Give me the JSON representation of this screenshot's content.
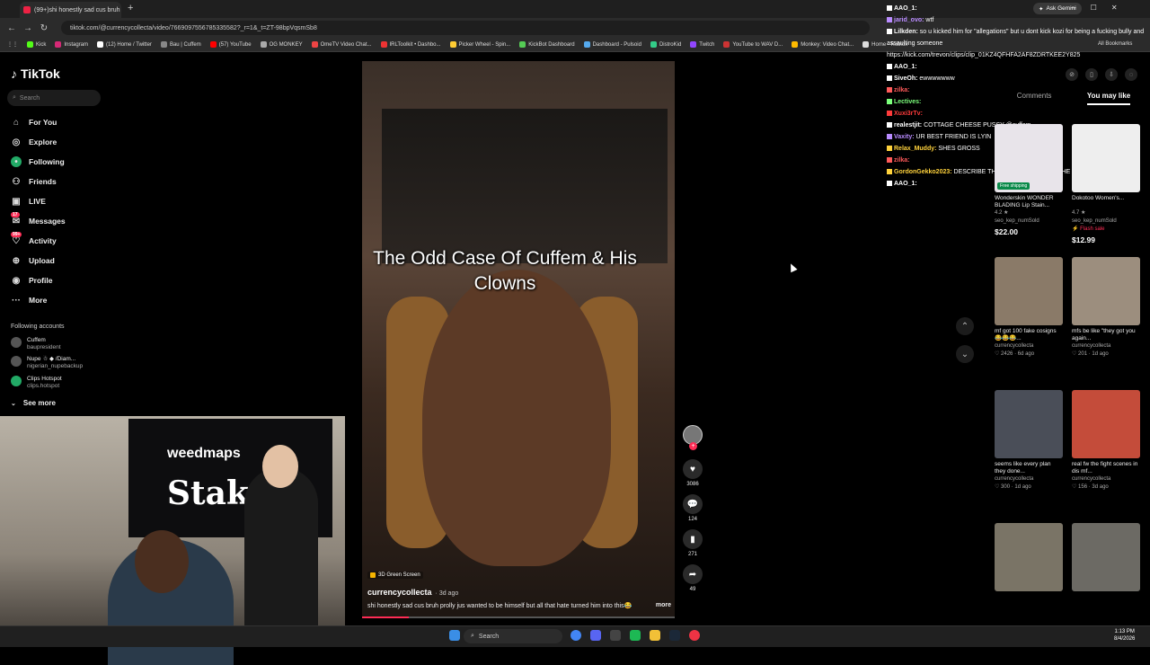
{
  "browser": {
    "tab_title": "(99+)shi honestly sad cus bruh",
    "url": "tiktok.com/@currencycollecta/video/7669097556785335582?_r=1&_t=ZT-98bpVqsmSb8",
    "gemini": "Ask Gemini",
    "bookmarks": [
      "Kick",
      "Instagram",
      "(12) Home / Twitter",
      "Bau | Cuffem",
      "(57) YouTube",
      "OG MONKEY",
      "OmeTV Video Chat...",
      "IRLToolkit • Dashbo...",
      "Picker Wheel - Spin...",
      "KickBot Dashboard",
      "Dashboard - Pulsoid",
      "DistroKid",
      "Twitch",
      "YouTube to WAV D...",
      "Monkey: Video Chat...",
      "Home - Roblox"
    ],
    "all_bookmarks": "All Bookmarks"
  },
  "tiktok": {
    "logo": "TikTok",
    "search_placeholder": "Search",
    "nav": [
      {
        "label": "For You",
        "icon": "home-icon"
      },
      {
        "label": "Explore",
        "icon": "compass-icon"
      },
      {
        "label": "Following",
        "icon": "following-icon"
      },
      {
        "label": "Friends",
        "icon": "friends-icon"
      },
      {
        "label": "LIVE",
        "icon": "live-icon"
      },
      {
        "label": "Messages",
        "icon": "messages-icon",
        "badge": "17"
      },
      {
        "label": "Activity",
        "icon": "activity-icon",
        "badge": "99+"
      },
      {
        "label": "Upload",
        "icon": "upload-icon"
      },
      {
        "label": "Profile",
        "icon": "profile-icon"
      },
      {
        "label": "More",
        "icon": "more-icon"
      }
    ],
    "following_header": "Following accounts",
    "following": [
      {
        "name": "Cuffem",
        "handle": "baupresident"
      },
      {
        "name": "Nupe ☃ ◆ /Diam...",
        "handle": "nigerian_nupebackup"
      },
      {
        "name": "Clips Hotspot",
        "handle": "clips.hotspot"
      }
    ],
    "see_more": "See more"
  },
  "stream": {
    "banner_brand": "weedmaps",
    "banner_text": "Stake"
  },
  "video": {
    "title": "The Odd Case Of Cuffem & His Clowns",
    "effect": "3D Green Screen",
    "author": "currencycollecta",
    "age": "· 3d ago",
    "caption": "shi honestly sad cus bruh prolly jus wanted to be himself but all that hate turned him into this😂",
    "more": "more",
    "likes": "3086",
    "comments": "124",
    "saves": "271",
    "shares": "49",
    "progress": 0.15
  },
  "chat": [
    {
      "user": "AAO_1:",
      "msg": "",
      "color": "#ffffff"
    },
    {
      "user": "jarid_ovo:",
      "msg": "wtf",
      "color": "#b98bff"
    },
    {
      "user": "Lilkden:",
      "msg": "so u kicked him for \"allegations\" but u dont kick kozi for being a fucking bully and assaulting someone",
      "color": "#ffffff"
    },
    {
      "user": "",
      "msg": "https://kick.com/trevon/clips/clip_01KZ4QFHFA2AF8ZDRTKEE2Y825",
      "color": "#ffffff"
    },
    {
      "user": "AAO_1:",
      "msg": "",
      "color": "#ffffff"
    },
    {
      "user": "SiveOh:",
      "msg": "ewwwwwww",
      "color": "#ffffff"
    },
    {
      "user": "zilka:",
      "msg": "",
      "color": "#ff5a5a"
    },
    {
      "user": "Lectives:",
      "msg": "",
      "color": "#7cff7c"
    },
    {
      "user": "Xuxi3rTv:",
      "msg": "",
      "color": "#ff3b3b"
    },
    {
      "user": "realestjit:",
      "msg": "COTTAGE CHEESE PUSSY @cuffem",
      "color": "#ffffff"
    },
    {
      "user": "Vaxity:",
      "msg": "UR BEST FRIEND IS LYIN",
      "color": "#b98bff"
    },
    {
      "user": "Relax_Muddy:",
      "msg": "SHES GROSS",
      "color": "#ffd23c"
    },
    {
      "user": "zilka:",
      "msg": "",
      "color": "#ff5a5a"
    },
    {
      "user": "GordonGekko2023:",
      "msg": "DESCRIBE THE SMELL DESCRIBE THE SMELL",
      "color": "#ffd23c"
    },
    {
      "user": "AAO_1:",
      "msg": "",
      "color": "#ffffff"
    }
  ],
  "right_panel": {
    "tab_comments": "Comments",
    "tab_like": "You may like",
    "products": [
      {
        "name": "Wonderskin WONDER BLADING Lip Stain...",
        "rating": "4.2 ★",
        "sold": "seo_kep_numSold",
        "price": "$22.00",
        "tag": "Free shipping",
        "color": "#e8e4ea"
      },
      {
        "name": "Dokotoo Women's...",
        "rating": "4.7 ★",
        "sold": "seo_kep_numSold",
        "price": "$12.99",
        "tag": "⚡ Flash sale",
        "color": "#eeeeee"
      }
    ],
    "videos": [
      {
        "title": "mf got 100 fake cosigns😂😂😂...",
        "author": "currencycollecta",
        "likes": "♡ 2426",
        "age": "· 6d ago",
        "color": "#8a7a68"
      },
      {
        "title": "mfs be like \"they got you again...",
        "author": "currencycollecta",
        "likes": "♡ 201",
        "age": "· 1d ago",
        "color": "#9c8e7e"
      },
      {
        "title": "seems like every plan they done...",
        "author": "currencycollecta",
        "likes": "♡ 300",
        "age": "· 1d ago",
        "color": "#4a4e58"
      },
      {
        "title": "real fw the fight scenes in dis mf...",
        "author": "currencycollecta",
        "likes": "♡ 156",
        "age": "· 3d ago",
        "color": "#c44c3a"
      },
      {
        "title": "",
        "author": "",
        "likes": "",
        "age": "",
        "color": "#7a7466"
      },
      {
        "title": "",
        "author": "",
        "likes": "",
        "age": "",
        "color": "#6c6a64"
      }
    ]
  },
  "taskbar": {
    "search": "Search",
    "time": "1:13 PM",
    "date": "8/4/2026"
  }
}
